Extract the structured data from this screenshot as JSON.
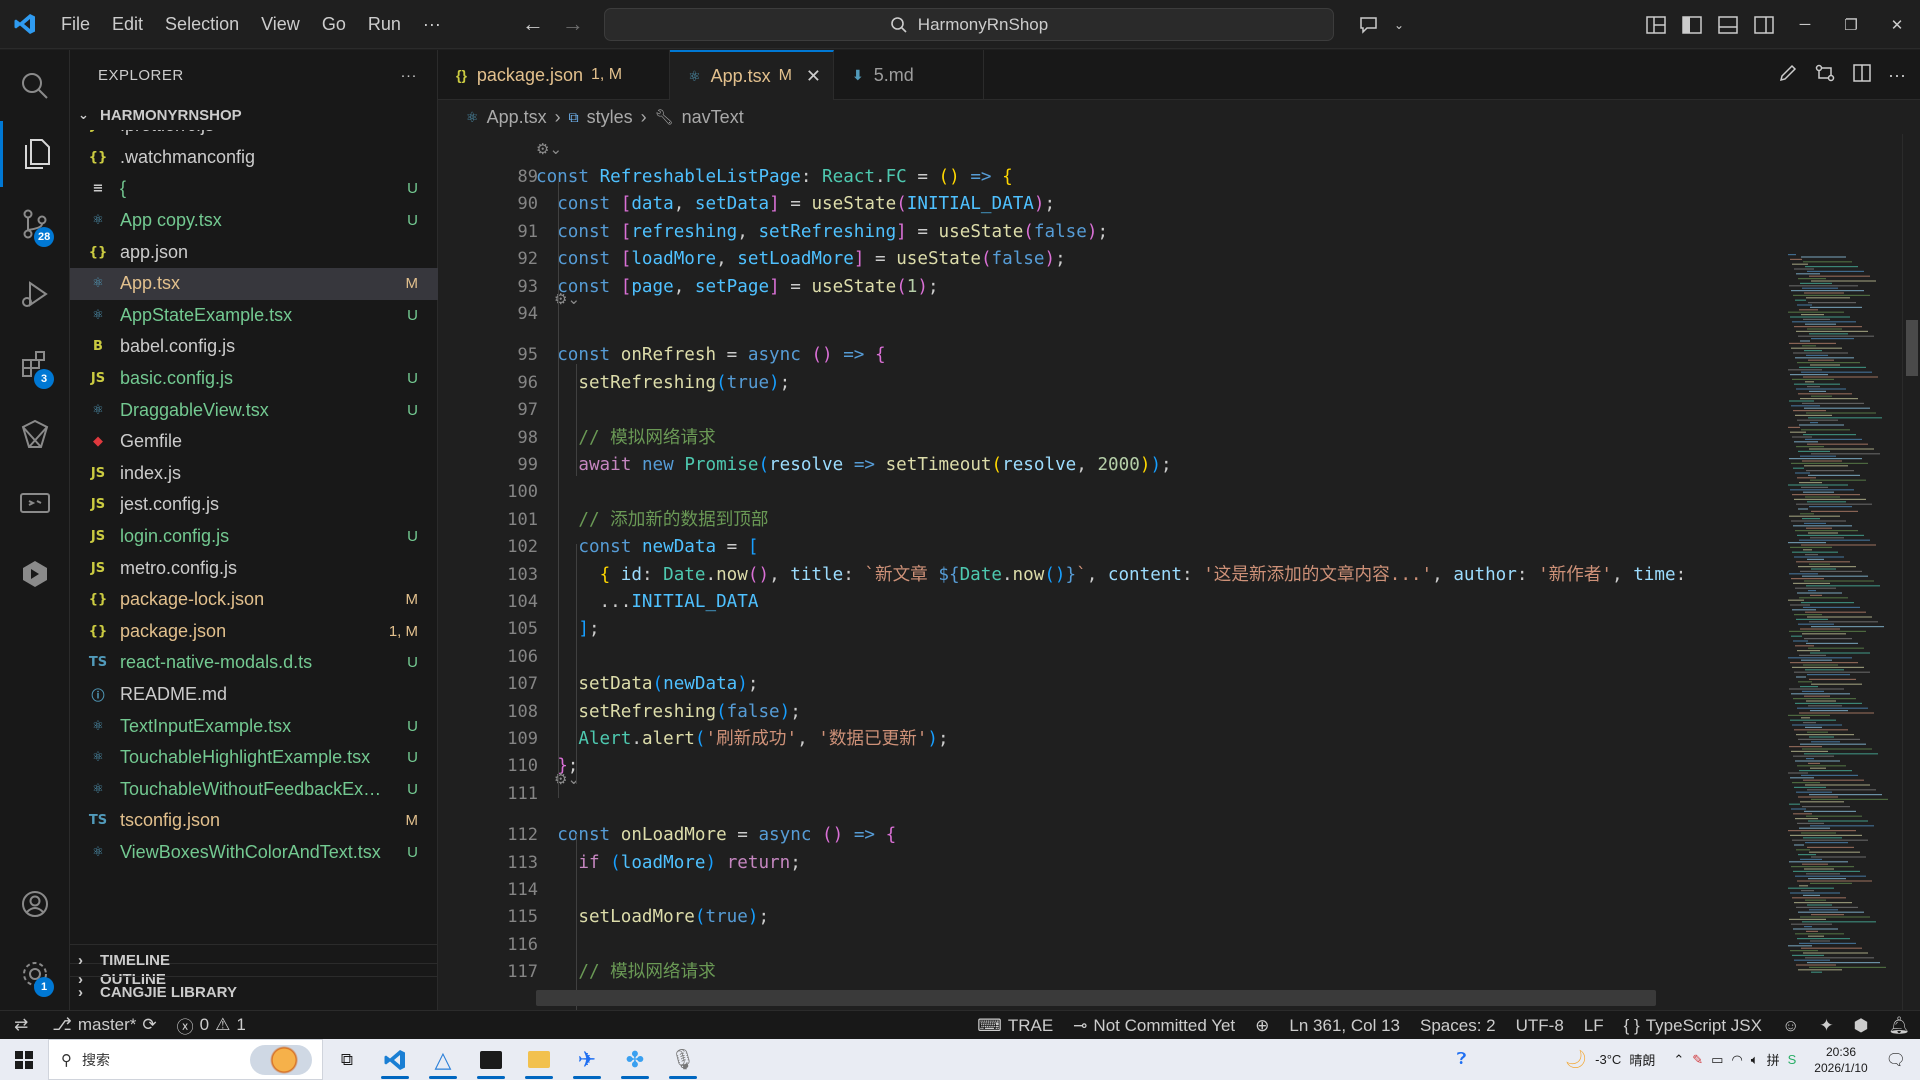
{
  "titlebar": {
    "menu": [
      "File",
      "Edit",
      "Selection",
      "View",
      "Go",
      "Run",
      "···"
    ],
    "search": "HarmonyRnShop"
  },
  "activity": {
    "scm_badge": "28",
    "extensions_badge": "3",
    "settings_badge": "1"
  },
  "sidebar": {
    "title": "EXPLORER",
    "more": "···",
    "root": "HARMONYRNSHOP",
    "files": [
      {
        "icon": "JS",
        "name": ".prettierrc.js",
        "status": "",
        "state": "normal",
        "icolor": "#cbcb41"
      },
      {
        "icon": "{}",
        "name": ".watchmanconfig",
        "status": "",
        "state": "normal",
        "icolor": "#cbcb41"
      },
      {
        "icon": "≡",
        "name": "{",
        "status": "U",
        "state": "untracked",
        "icolor": "#cccccc"
      },
      {
        "icon": "⚛",
        "name": "App copy.tsx",
        "status": "U",
        "state": "untracked",
        "icolor": "#519aba"
      },
      {
        "icon": "{}",
        "name": "app.json",
        "status": "",
        "state": "normal",
        "icolor": "#cbcb41"
      },
      {
        "icon": "⚛",
        "name": "App.tsx",
        "status": "M",
        "state": "modified",
        "icolor": "#519aba"
      },
      {
        "icon": "⚛",
        "name": "AppStateExample.tsx",
        "status": "U",
        "state": "untracked",
        "icolor": "#519aba"
      },
      {
        "icon": "B",
        "name": "babel.config.js",
        "status": "",
        "state": "normal",
        "icolor": "#cbcb41"
      },
      {
        "icon": "JS",
        "name": "basic.config.js",
        "status": "U",
        "state": "untracked",
        "icolor": "#cbcb41"
      },
      {
        "icon": "⚛",
        "name": "DraggableView.tsx",
        "status": "U",
        "state": "untracked",
        "icolor": "#519aba"
      },
      {
        "icon": "◆",
        "name": "Gemfile",
        "status": "",
        "state": "normal",
        "icolor": "#e0393e"
      },
      {
        "icon": "JS",
        "name": "index.js",
        "status": "",
        "state": "normal",
        "icolor": "#cbcb41"
      },
      {
        "icon": "JS",
        "name": "jest.config.js",
        "status": "",
        "state": "normal",
        "icolor": "#cbcb41"
      },
      {
        "icon": "JS",
        "name": "login.config.js",
        "status": "U",
        "state": "untracked",
        "icolor": "#cbcb41"
      },
      {
        "icon": "JS",
        "name": "metro.config.js",
        "status": "",
        "state": "normal",
        "icolor": "#cbcb41"
      },
      {
        "icon": "{}",
        "name": "package-lock.json",
        "status": "M",
        "state": "modified",
        "icolor": "#cbcb41"
      },
      {
        "icon": "{}",
        "name": "package.json",
        "status": "1, M",
        "state": "modified",
        "icolor": "#cbcb41"
      },
      {
        "icon": "TS",
        "name": "react-native-modals.d.ts",
        "status": "U",
        "state": "untracked",
        "icolor": "#519aba"
      },
      {
        "icon": "ⓘ",
        "name": "README.md",
        "status": "",
        "state": "normal",
        "icolor": "#519aba"
      },
      {
        "icon": "⚛",
        "name": "TextInputExample.tsx",
        "status": "U",
        "state": "untracked",
        "icolor": "#519aba"
      },
      {
        "icon": "⚛",
        "name": "TouchableHighlightExample.tsx",
        "status": "U",
        "state": "untracked",
        "icolor": "#519aba"
      },
      {
        "icon": "⚛",
        "name": "TouchableWithoutFeedbackExa...",
        "status": "U",
        "state": "untracked",
        "icolor": "#519aba"
      },
      {
        "icon": "TS",
        "name": "tsconfig.json",
        "status": "M",
        "state": "modified",
        "icolor": "#519aba"
      },
      {
        "icon": "⚛",
        "name": "ViewBoxesWithColorAndText.tsx",
        "status": "U",
        "state": "untracked",
        "icolor": "#519aba"
      }
    ],
    "sections": [
      "OUTLINE",
      "TIMELINE",
      "CANGJIE LIBRARY"
    ]
  },
  "tabs": [
    {
      "icon": "{}",
      "label": "package.json",
      "status": "1, M",
      "active": false
    },
    {
      "icon": "⚛",
      "label": "App.tsx",
      "status": "M",
      "active": true
    },
    {
      "icon": "⬇",
      "label": "5.md",
      "status": "",
      "active": false
    }
  ],
  "breadcrumb": [
    "App.tsx",
    "styles",
    "navText"
  ],
  "editor": {
    "lines": [
      {
        "n": "89",
        "html": "<span class='k'>const</span> <span class='c'>RefreshableListPage</span>: <span class='t'>React</span>.<span class='t'>FC</span> = <span class='b1'>()</span> <span class='k'>=&gt;</span> <span class='b1'>{</span>"
      },
      {
        "n": "90",
        "html": "  <span class='k'>const</span> <span class='b2'>[</span><span class='c'>data</span>, <span class='c'>setData</span><span class='b2'>]</span> = <span class='f'>useState</span><span class='b2'>(</span><span class='c'>INITIAL_DATA</span><span class='b2'>)</span>;"
      },
      {
        "n": "91",
        "html": "  <span class='k'>const</span> <span class='b2'>[</span><span class='c'>refreshing</span>, <span class='c'>setRefreshing</span><span class='b2'>]</span> = <span class='f'>useState</span><span class='b2'>(</span><span class='k'>false</span><span class='b2'>)</span>;"
      },
      {
        "n": "92",
        "html": "  <span class='k'>const</span> <span class='b2'>[</span><span class='c'>loadMore</span>, <span class='c'>setLoadMore</span><span class='b2'>]</span> = <span class='f'>useState</span><span class='b2'>(</span><span class='k'>false</span><span class='b2'>)</span>;"
      },
      {
        "n": "93",
        "html": "  <span class='k'>const</span> <span class='b2'>[</span><span class='c'>page</span>, <span class='c'>setPage</span><span class='b2'>]</span> = <span class='f'>useState</span><span class='b2'>(</span><span class='n'>1</span><span class='b2'>)</span>;"
      },
      {
        "n": "94",
        "html": ""
      },
      {
        "n": "95",
        "html": "  <span class='k'>const</span> <span class='f'>onRefresh</span> = <span class='k'>async</span> <span class='b2'>()</span> <span class='k'>=&gt;</span> <span class='b2'>{</span>"
      },
      {
        "n": "96",
        "html": "    <span class='f'>setRefreshing</span><span class='b3'>(</span><span class='k'>true</span><span class='b3'>)</span>;"
      },
      {
        "n": "97",
        "html": ""
      },
      {
        "n": "98",
        "html": "    <span class='cm'>// 模拟网络请求</span>"
      },
      {
        "n": "99",
        "html": "    <span class='kc'>await</span> <span class='k'>new</span> <span class='t'>Promise</span><span class='b3'>(</span><span class='v'>resolve</span> <span class='k'>=&gt;</span> <span class='f'>setTimeout</span><span class='b1'>(</span><span class='v'>resolve</span>, <span class='n'>2000</span><span class='b1'>)</span><span class='b3'>)</span>;"
      },
      {
        "n": "100",
        "html": ""
      },
      {
        "n": "101",
        "html": "    <span class='cm'>// 添加新的数据到顶部</span>"
      },
      {
        "n": "102",
        "html": "    <span class='k'>const</span> <span class='c'>newData</span> = <span class='b3'>[</span>"
      },
      {
        "n": "103",
        "html": "      <span class='b1'>{</span> <span class='v'>id</span>: <span class='t'>Date</span>.<span class='f'>now</span><span class='b2'>()</span>, <span class='v'>title</span>: <span class='s'>`新文章 </span><span class='k'>${</span><span class='t'>Date</span>.<span class='f'>now</span><span class='b3'>()</span><span class='k'>}</span><span class='s'>`</span>, <span class='v'>content</span>: <span class='s'>'这是新添加的文章内容...'</span>, <span class='v'>author</span>: <span class='s'>'新作者'</span>, <span class='v'>time</span>:"
      },
      {
        "n": "104",
        "html": "      ...<span class='c'>INITIAL_DATA</span>"
      },
      {
        "n": "105",
        "html": "    <span class='b3'>]</span>;"
      },
      {
        "n": "106",
        "html": ""
      },
      {
        "n": "107",
        "html": "    <span class='f'>setData</span><span class='b3'>(</span><span class='c'>newData</span><span class='b3'>)</span>;"
      },
      {
        "n": "108",
        "html": "    <span class='f'>setRefreshing</span><span class='b3'>(</span><span class='k'>false</span><span class='b3'>)</span>;"
      },
      {
        "n": "109",
        "html": "    <span class='t'>Alert</span>.<span class='f'>alert</span><span class='b3'>(</span><span class='s'>'刷新成功'</span>, <span class='s'>'数据已更新'</span><span class='b3'>)</span>;"
      },
      {
        "n": "110",
        "html": "  <span class='b2'>}</span>;"
      },
      {
        "n": "111",
        "html": ""
      },
      {
        "n": "112",
        "html": "  <span class='k'>const</span> <span class='f'>onLoadMore</span> = <span class='k'>async</span> <span class='b2'>()</span> <span class='k'>=&gt;</span> <span class='b2'>{</span>"
      },
      {
        "n": "113",
        "html": "    <span class='kc'>if</span> <span class='b3'>(</span><span class='c'>loadMore</span><span class='b3'>)</span> <span class='kc'>return</span>;"
      },
      {
        "n": "114",
        "html": ""
      },
      {
        "n": "115",
        "html": "    <span class='f'>setLoadMore</span><span class='b3'>(</span><span class='k'>true</span><span class='b3'>)</span>;"
      },
      {
        "n": "116",
        "html": ""
      },
      {
        "n": "117",
        "html": "    <span class='cm'>// 模拟网络请求</span>"
      }
    ]
  },
  "statusbar": {
    "branch": "master*",
    "errors": "0",
    "warnings": "1",
    "trae": "TRAE",
    "commit": "Not Committed Yet",
    "position": "Ln 361, Col 13",
    "spaces": "Spaces: 2",
    "encoding": "UTF-8",
    "eol": "LF",
    "language": "TypeScript JSX"
  },
  "taskbar": {
    "search_placeholder": "搜索",
    "weather": "-3°C",
    "weather_desc": "晴朗",
    "time": "20:36",
    "date": "2026/1/10"
  }
}
